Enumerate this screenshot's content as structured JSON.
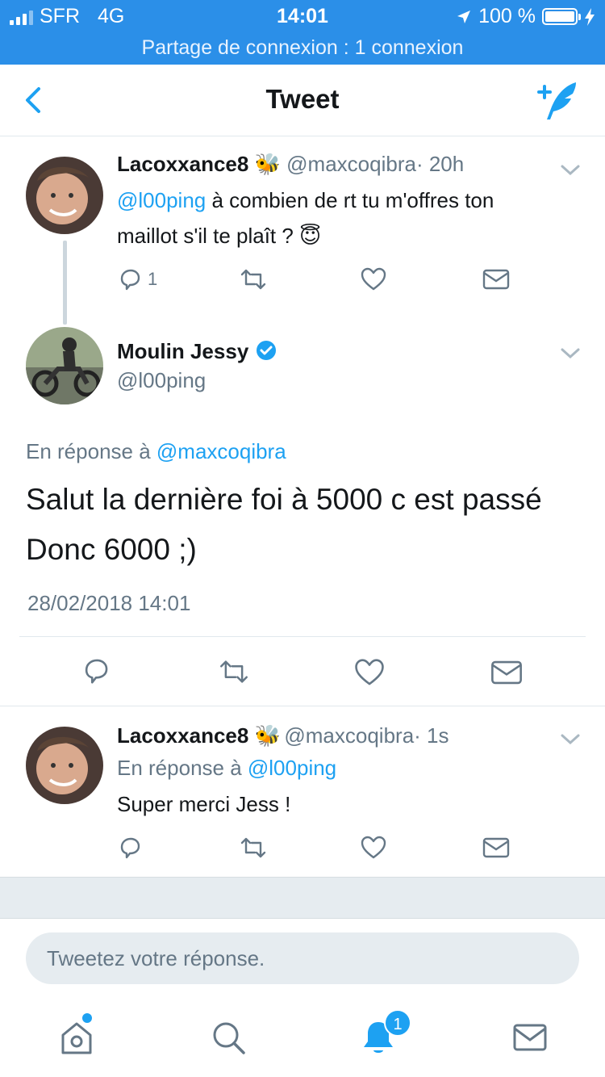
{
  "status_bar": {
    "carrier": "SFR",
    "network": "4G",
    "time": "14:01",
    "battery": "100 %",
    "hotspot": "Partage de connexion : 1 connexion"
  },
  "nav": {
    "title": "Tweet",
    "back_icon": "chevron-left-icon",
    "compose_icon": "compose-tweet-icon"
  },
  "tweet1": {
    "name": "Lacoxxance8 🐝",
    "handle": "@maxcoqibra",
    "time": "· 20h",
    "mention": "@l00ping",
    "text_line1": " à combien de rt tu m'offres ton",
    "text_line2": "maillot s'il te plaît ? 😇",
    "reply_count": "1"
  },
  "main_tweet": {
    "name": "Moulin Jessy",
    "handle": "@l00ping",
    "reply_prefix": "En réponse à ",
    "reply_to": "@maxcoqibra",
    "text_line1": "Salut la dernière foi à 5000 c est passé",
    "text_line2": "Donc 6000 ;)",
    "timestamp": "28/02/2018 14:01"
  },
  "tweet3": {
    "name": "Lacoxxance8 🐝",
    "handle": "@maxcoqibra",
    "time": "· 1s",
    "reply_prefix": "En réponse à ",
    "reply_to": "@l00ping",
    "text": "Super merci Jess !"
  },
  "reply_box": {
    "placeholder": "Tweetez votre réponse."
  },
  "tabbar": {
    "notification_count": "1"
  },
  "colors": {
    "status_bar": "#2b8fe8",
    "accent": "#1da1f2",
    "muted": "#657786"
  }
}
